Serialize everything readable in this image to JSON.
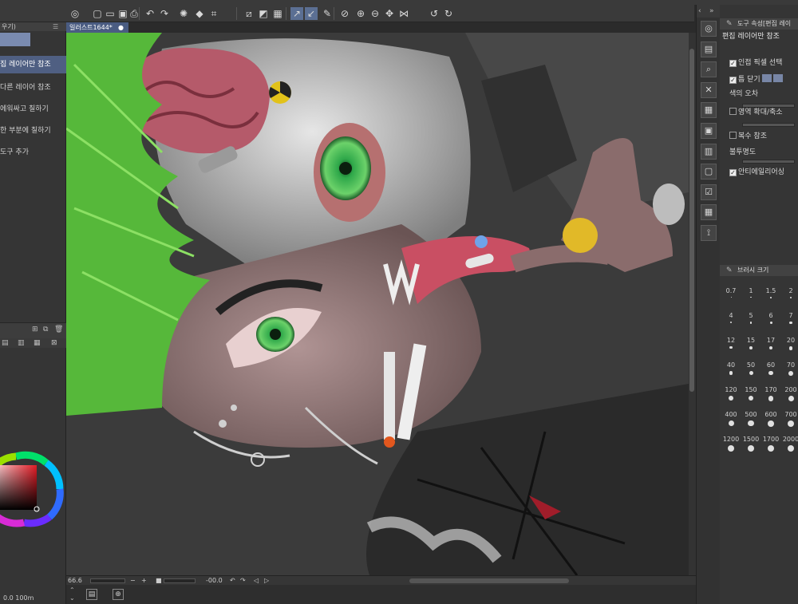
{
  "colors": {
    "accent": "#5b6f93",
    "panel": "#353535",
    "canvas_bg": "#3b3b3b",
    "hair": "#56b83a",
    "iris": "#2fa84a"
  },
  "toolbar": {
    "icons": [
      "app-logo-icon",
      "new-file-icon",
      "open-file-icon",
      "save-icon",
      "print-icon",
      "undo-icon",
      "redo-icon",
      "selection-spinner-icon",
      "fill-icon",
      "transform-icon",
      "snap-off-icon",
      "snap-ruler-icon",
      "snap-grid-icon",
      "pen-stabilizer-icon",
      "pen-correction-icon",
      "pen-pressure-icon",
      "navigator-icon",
      "zoom-in-icon",
      "zoom-out-icon",
      "pan-icon",
      "flip-icon",
      "rotate-left-icon",
      "rotate-right-icon"
    ]
  },
  "left_panel": {
    "header": "우기)",
    "subtools": [
      {
        "label": "집 레이어만 참조",
        "selected": true
      },
      {
        "label": "다른 레이어 참조",
        "selected": false
      },
      {
        "label": "에워싸고 칠하기",
        "selected": false
      },
      {
        "label": "한 부분에 칠하기",
        "selected": false
      },
      {
        "label": "도구 추가",
        "selected": false
      }
    ],
    "bottom_text": "0.0",
    "bottom_value": "100",
    "bottom_unit": "m"
  },
  "document": {
    "tab_label": "일러스트1644*",
    "tab_close": "●"
  },
  "status_bar": {
    "zoom": "66.6",
    "angle": "-00.0"
  },
  "side_strip": {
    "icons": [
      "navigator-icon",
      "layer-property-icon",
      "layer-search-icon",
      "close-panel-icon",
      "material-icon",
      "animation-icon",
      "color-set-icon",
      "sub-view-icon",
      "history-icon",
      "auto-action-icon",
      "tool-property-icon"
    ]
  },
  "right_panel": {
    "header": "도구 속성[편집 레이",
    "title": "편집 레이어만 참조",
    "options": [
      {
        "label": "인접 픽셀 선택",
        "checked": true
      },
      {
        "label": "틈 닫기",
        "checked": true
      },
      {
        "label": "색의 오차",
        "checked": null
      },
      {
        "label": "영역 확대/축소",
        "checked": false
      },
      {
        "label": "복수 참조",
        "checked": false
      },
      {
        "label": "불투명도",
        "checked": null
      },
      {
        "label": "안티에일리어싱",
        "checked": true
      }
    ],
    "brush_header": "브러시 크기",
    "brush_sizes": [
      "0.7",
      "1",
      "1.5",
      "2",
      "4",
      "5",
      "6",
      "7",
      "12",
      "15",
      "17",
      "20",
      "40",
      "50",
      "60",
      "70",
      "120",
      "150",
      "170",
      "200",
      "400",
      "500",
      "600",
      "700",
      "1200",
      "1500",
      "1700",
      "2000"
    ]
  }
}
